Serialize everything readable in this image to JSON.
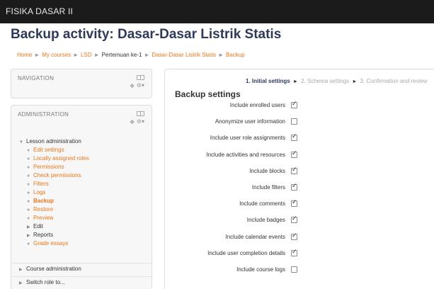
{
  "app": {
    "brand": "FISIKA DASAR II"
  },
  "page": {
    "title": "Backup activity: Dasar-Dasar Listrik Statis"
  },
  "breadcrumb": [
    {
      "label": "Home",
      "kind": "link"
    },
    {
      "label": "My courses",
      "kind": "link"
    },
    {
      "label": "LSD",
      "kind": "link"
    },
    {
      "label": "Pertemuan ke-1",
      "kind": "plain"
    },
    {
      "label": "Dasar-Dasar Listrik Statis",
      "kind": "link"
    },
    {
      "label": "Backup",
      "kind": "link"
    }
  ],
  "breadcrumb_separator": "►",
  "navigation": {
    "title": "NAVIGATION"
  },
  "administration": {
    "title": "ADMINISTRATION",
    "lesson_admin": "Lesson administration",
    "items": [
      {
        "label": "Edit settings",
        "kind": "link"
      },
      {
        "label": "Locally assigned roles",
        "kind": "link"
      },
      {
        "label": "Permissions",
        "kind": "link"
      },
      {
        "label": "Check permissions",
        "kind": "link"
      },
      {
        "label": "Filters",
        "kind": "link"
      },
      {
        "label": "Logs",
        "kind": "link"
      },
      {
        "label": "Backup",
        "kind": "active"
      },
      {
        "label": "Restore",
        "kind": "link"
      },
      {
        "label": "Preview",
        "kind": "link"
      },
      {
        "label": "Edit",
        "kind": "expandable"
      },
      {
        "label": "Reports",
        "kind": "expandable"
      },
      {
        "label": "Grade essays",
        "kind": "link"
      }
    ],
    "course_admin": "Course administration",
    "switch_role": "Switch role to..."
  },
  "progress": {
    "step1": "1. Initial settings",
    "step2": "2. Schema settings",
    "step3": "3. Confirmation and review",
    "arrow": "►"
  },
  "backup_settings": {
    "title": "Backup settings",
    "items": [
      {
        "label": "Include enrolled users",
        "checked": true
      },
      {
        "label": "Anonymize user information",
        "checked": false
      },
      {
        "label": "Include user role assignments",
        "checked": true
      },
      {
        "label": "Include activities and resources",
        "checked": true
      },
      {
        "label": "Include blocks",
        "checked": true
      },
      {
        "label": "Include filters",
        "checked": true
      },
      {
        "label": "Include comments",
        "checked": true
      },
      {
        "label": "Include badges",
        "checked": true
      },
      {
        "label": "Include calendar events",
        "checked": true
      },
      {
        "label": "Include user completion details",
        "checked": true
      },
      {
        "label": "Include course logs",
        "checked": false
      }
    ]
  },
  "icons": {
    "bullet": "●",
    "expand_arrow": "▶",
    "collapse_arrow": "▼",
    "move": "✥",
    "gear": "⚙"
  },
  "colors": {
    "topbar": "#1b1b1b",
    "title": "#2e3a57",
    "link": "#e8781e"
  }
}
